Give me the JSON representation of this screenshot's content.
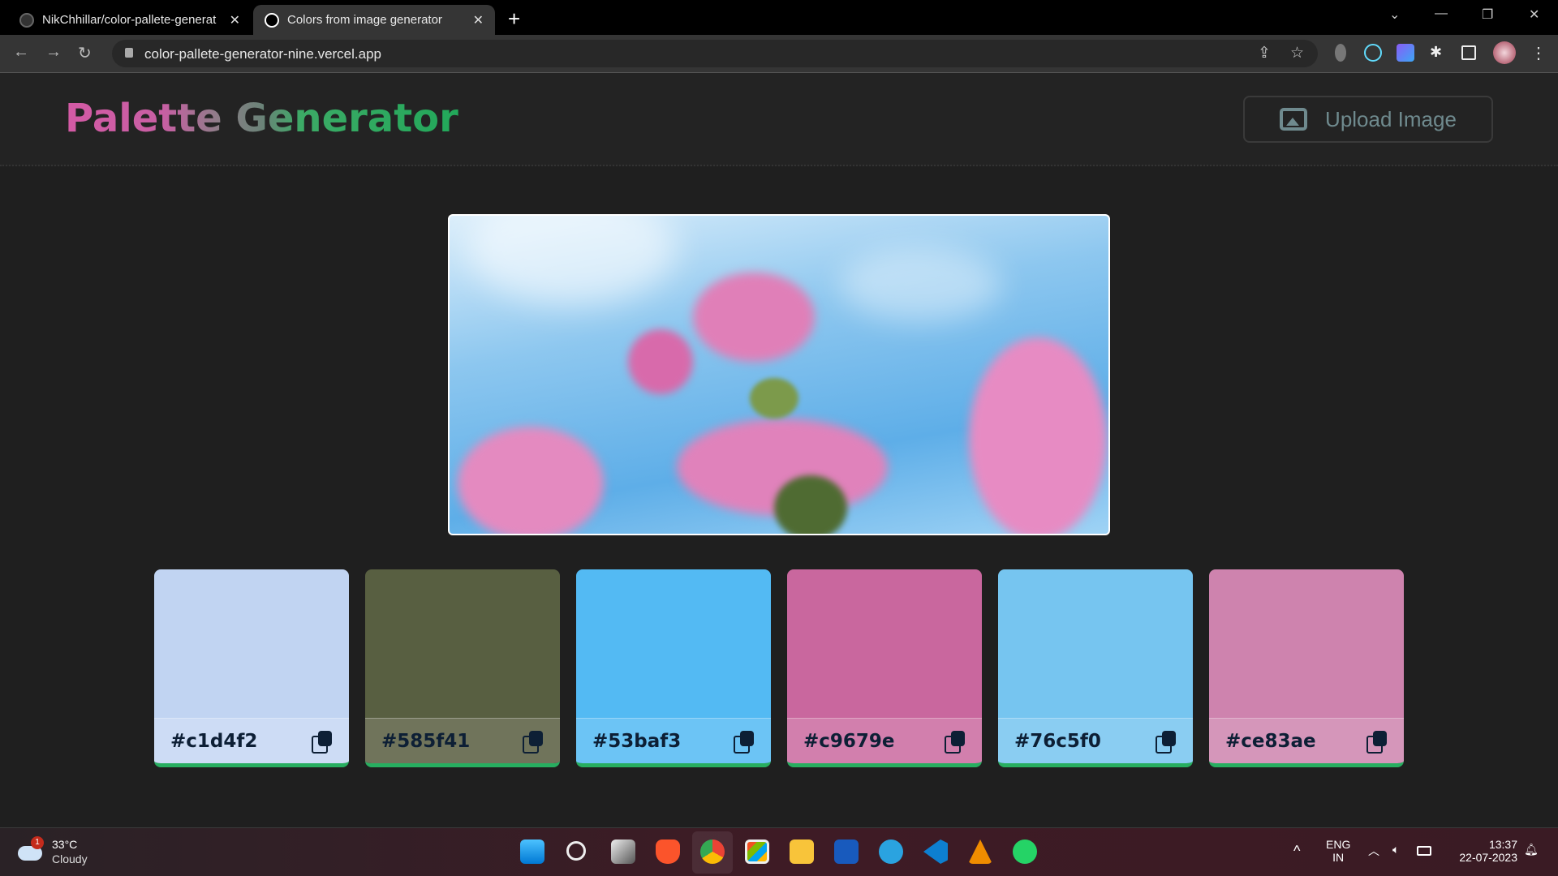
{
  "browser": {
    "tabs": [
      {
        "label": "NikChhillar/color-pallete-generat",
        "icon": "github-icon",
        "active": false
      },
      {
        "label": "Colors from image generator",
        "icon": "vercel-icon",
        "active": true
      }
    ],
    "close_glyph": "✕",
    "newtab_glyph": "+",
    "url": "color-pallete-generator-nine.vercel.app"
  },
  "header": {
    "title": "Palette Generator",
    "upload_label": "Upload Image"
  },
  "palette": [
    {
      "hex": "#c1d4f2",
      "color": "#c1d4f2",
      "label_bg": "#cddcf5"
    },
    {
      "hex": "#585f41",
      "color": "#585f41",
      "label_bg": "#70745b"
    },
    {
      "hex": "#53baf3",
      "color": "#53baf3",
      "label_bg": "#6cc4f5"
    },
    {
      "hex": "#c9679e",
      "color": "#c9679e",
      "label_bg": "#d27fad"
    },
    {
      "hex": "#76c5f0",
      "color": "#76c5f0",
      "label_bg": "#8acdf2"
    },
    {
      "hex": "#ce83ae",
      "color": "#ce83ae",
      "label_bg": "#d596ba"
    }
  ],
  "accent": "#27ae60",
  "taskbar": {
    "weather_temp": "33°C",
    "weather_desc": "Cloudy",
    "weather_badge": "1",
    "lang1": "ENG",
    "lang2": "IN",
    "time": "13:37",
    "date": "22-07-2023",
    "apps": [
      "windows-start",
      "search",
      "task-view",
      "brave",
      "chrome",
      "ms-store",
      "file-explorer",
      "word",
      "telegram",
      "vscode",
      "vlc",
      "whatsapp"
    ]
  }
}
